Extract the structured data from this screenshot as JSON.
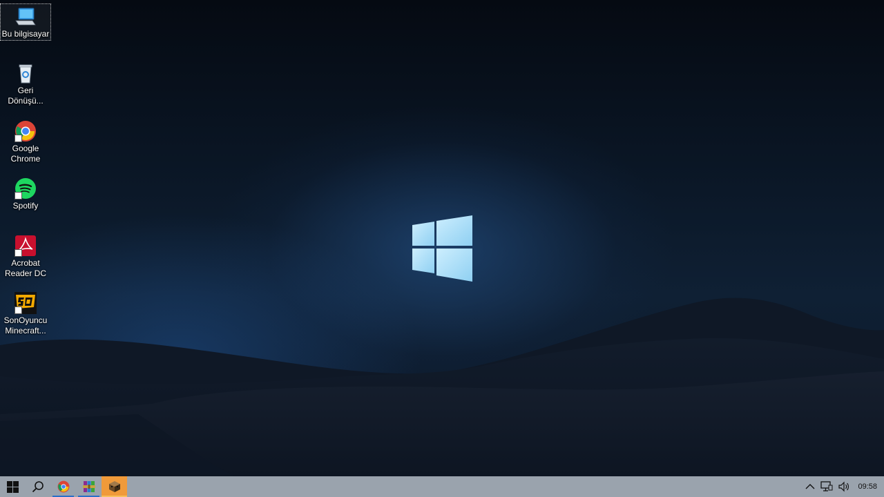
{
  "desktop": {
    "icons": [
      {
        "label": "Bu bilgisayar",
        "icon": "computer-icon",
        "selected": true
      },
      {
        "label": "Geri Dönüşü...",
        "icon": "recycle-bin-icon"
      },
      {
        "label": "Google Chrome",
        "icon": "chrome-icon"
      },
      {
        "label": "Spotify",
        "icon": "spotify-icon"
      },
      {
        "label": "Acrobat Reader DC",
        "icon": "acrobat-icon"
      },
      {
        "label": "SonOyuncu Minecraft...",
        "icon": "sonoyuncu-icon"
      }
    ]
  },
  "taskbar": {
    "apps": [
      {
        "name": "start-button",
        "icon": "windows-logo-icon"
      },
      {
        "name": "search-button",
        "icon": "search-icon"
      },
      {
        "name": "chrome",
        "icon": "chrome-icon",
        "running": true
      },
      {
        "name": "winrar",
        "icon": "winrar-icon",
        "running": true
      },
      {
        "name": "minecraft",
        "icon": "minecraft-box-icon",
        "active": true
      }
    ],
    "tray": {
      "icons": [
        "chevron-up-icon",
        "network-icon",
        "volume-icon"
      ],
      "clock": "09:58"
    }
  },
  "colors": {
    "taskbar": "#9aa3ad",
    "active_app": "#f09a3a",
    "running_indicator": "#2a6fc9"
  }
}
